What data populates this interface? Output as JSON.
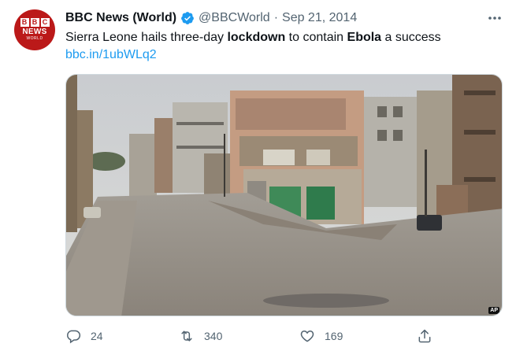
{
  "author": {
    "display_name": "BBC News (World)",
    "handle": "@BBCWorld",
    "separator": "·",
    "date": "Sep 21, 2014",
    "avatar": {
      "blocks": [
        "B",
        "B",
        "C"
      ],
      "line1": "NEWS",
      "line2": "WORLD"
    }
  },
  "tweet": {
    "text_parts": {
      "p1": "Sierra Leone hails three-day ",
      "b1": "lockdown",
      "p2": " to contain ",
      "b2": "Ebola",
      "p3": " a success"
    },
    "link": "bbc.in/1ubWLq2"
  },
  "media": {
    "credit": "AP"
  },
  "actions": {
    "reply_count": "24",
    "retweet_count": "340",
    "like_count": "169"
  },
  "icons": {
    "verified": "verified-badge-icon",
    "more": "more-icon",
    "reply": "reply-icon",
    "retweet": "retweet-icon",
    "like": "heart-icon",
    "share": "share-icon"
  },
  "colors": {
    "brand_red": "#bb1919",
    "link_blue": "#1d9bf0",
    "muted": "#536471",
    "text": "#0f1419"
  }
}
